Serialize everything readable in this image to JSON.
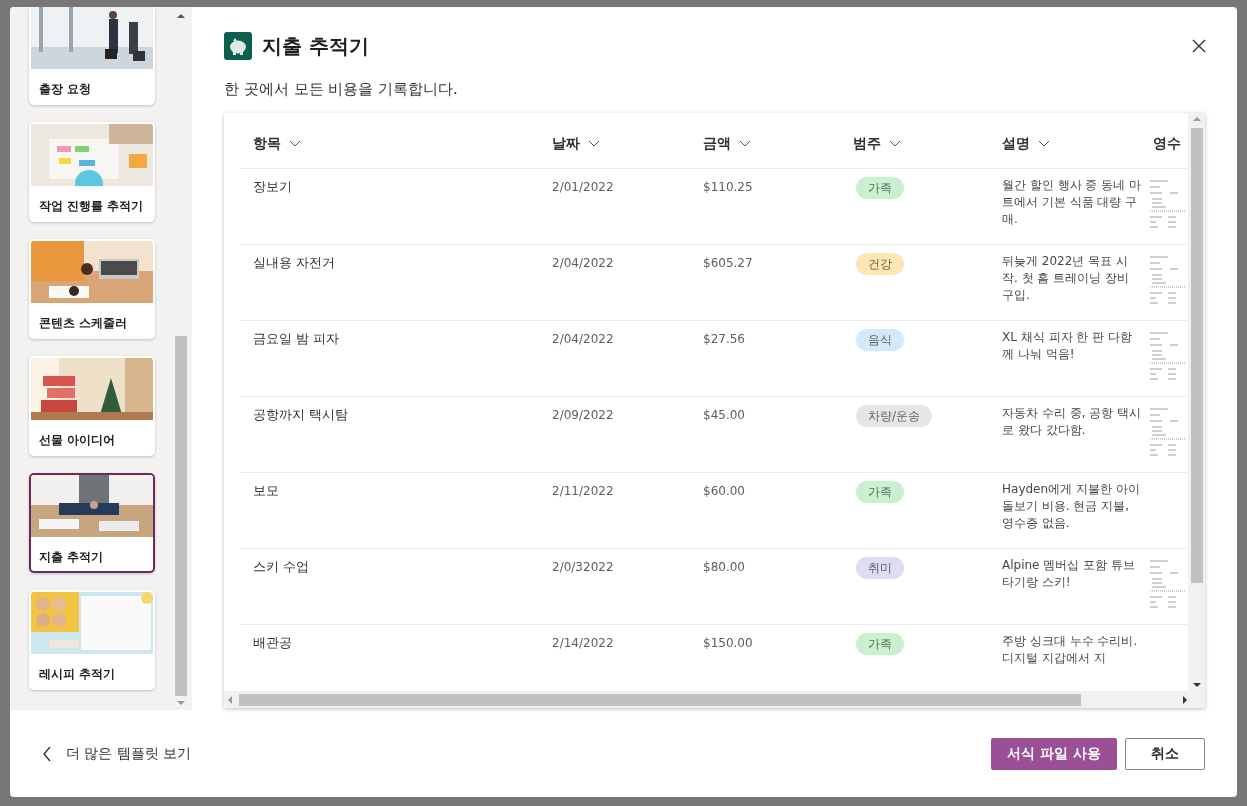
{
  "sidebar": {
    "templates": [
      {
        "label": "출장 요청",
        "selected": false
      },
      {
        "label": "작업 진행률 추적기",
        "selected": false
      },
      {
        "label": "콘텐츠 스케줄러",
        "selected": false
      },
      {
        "label": "선물 아이디어",
        "selected": false
      },
      {
        "label": "지출 추적기",
        "selected": true
      },
      {
        "label": "레시피 추적기",
        "selected": false
      }
    ]
  },
  "dialog": {
    "title": "지출 추적기",
    "subtitle": "한 곳에서 모든 비용을 기록합니다."
  },
  "table": {
    "columns": [
      "항목",
      "날짜",
      "금액",
      "범주",
      "설명",
      "영수"
    ],
    "rows": [
      {
        "item": "장보기",
        "date": "2/01/2022",
        "amount": "$110.25",
        "category": {
          "label": "가족",
          "color": "#c9f0cf"
        },
        "description": "월간 할인 행사 중 동네 마트에서 기본 식품 대량 구매.",
        "receipt": true
      },
      {
        "item": "실내용 자전거",
        "date": "2/04/2022",
        "amount": "$605.27",
        "category": {
          "label": "건강",
          "color": "#ffe7b5"
        },
        "description": "뒤늦게 2022년 목표 시작. 첫 홈 트레이닝 장비 구입.",
        "receipt": true
      },
      {
        "item": "금요일 밤 피자",
        "date": "2/04/2022",
        "amount": "$27.56",
        "category": {
          "label": "음식",
          "color": "#d4e8f8"
        },
        "description": "XL 채식 피자 한 판 다함께 나눠 먹음!",
        "receipt": true
      },
      {
        "item": "공항까지 택시탐",
        "date": "2/09/2022",
        "amount": "$45.00",
        "category": {
          "label": "차량/운송",
          "color": "#e6e6e6"
        },
        "description": "자동차 수리 중, 공항 택시로 왔다 갔다함.",
        "receipt": true
      },
      {
        "item": "보모",
        "date": "2/11/2022",
        "amount": "$60.00",
        "category": {
          "label": "가족",
          "color": "#c9f0cf"
        },
        "description": "Hayden에게 지불한 아이 돌보기 비용. 현금 지불, 영수증 없음.",
        "receipt": false
      },
      {
        "item": "스키 수업",
        "date": "2/0/32022",
        "amount": "$80.00",
        "category": {
          "label": "취미",
          "color": "#dcdcf2"
        },
        "description": "Alpine 멤버십 포함 튜브타기랑 스키!",
        "receipt": true
      },
      {
        "item": "배관공",
        "date": "2/14/2022",
        "amount": "$150.00",
        "category": {
          "label": "가족",
          "color": "#c9f0cf"
        },
        "description": "주방 싱크대 누수 수리비. 디지털 지갑에서 지",
        "receipt": false
      }
    ]
  },
  "footer": {
    "back_link": "더 많은 템플릿 보기",
    "primary_button": "서식 파일 사용",
    "cancel_button": "취소"
  }
}
